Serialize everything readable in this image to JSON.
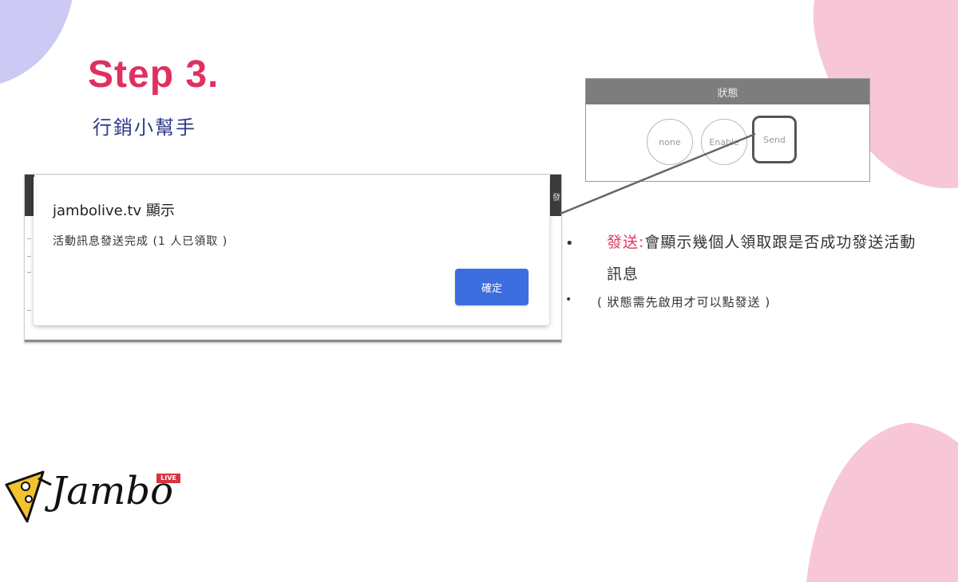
{
  "slide": {
    "step_title": "Step 3.",
    "subtitle": "行銷小幫手"
  },
  "colors": {
    "accent_pink": "#e0305f",
    "subtitle_blue": "#2e3a8a",
    "button_blue": "#3c6ee0",
    "blob_pink": "#f6c6d6",
    "blob_lavender": "#c9c6f4"
  },
  "dialog": {
    "title": "jambolive.tv 顯示",
    "message": "活動訊息發送完成 (1 人已領取 )",
    "ok_label": "確定"
  },
  "status_panel": {
    "header": "狀態",
    "options": [
      {
        "label": "none"
      },
      {
        "label": "Enable"
      },
      {
        "label": "Send"
      }
    ],
    "selected_index": 2
  },
  "background_table": {
    "side_label": "發"
  },
  "annotations": {
    "bullet_keyword": "發送:",
    "bullet_text": "會顯示幾個人領取跟是否成功發送活動訊息",
    "note": "( 狀態需先啟用才可以點發送 )"
  },
  "logo": {
    "brand": "Jambo",
    "badge": "LIVE",
    "icon": "cheese-pizza-icon"
  }
}
